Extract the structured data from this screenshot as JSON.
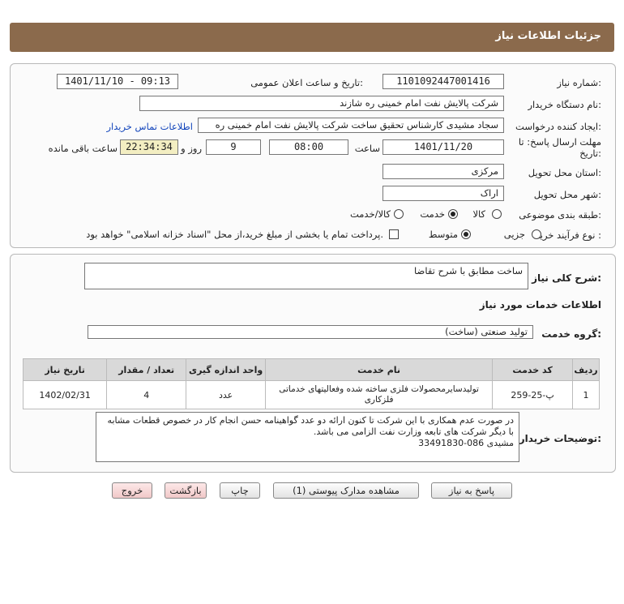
{
  "header": {
    "title": "جزئیات اطلاعات نیاز"
  },
  "fields": {
    "need_number_label": "شماره نیاز:",
    "need_number": "1101092447001416",
    "announce_label": "تاریخ و ساعت اعلان عمومی:",
    "announce_value": "1401/11/10 - 09:13",
    "buyer_org_label": "نام دستگاه خریدار:",
    "buyer_org": "شرکت پالایش نفت امام خمینی  ره   شازند",
    "creator_label": "ایجاد کننده درخواست:",
    "creator": "سجاد مشیدی  کارشناس تحقیق ساخت شرکت پالایش نفت امام خمینی  ره",
    "contact_link": "اطلاعات تماس خریدار",
    "deadline_label": "مهلت ارسال پاسخ: تا",
    "deadline_label2": "تاریخ:",
    "deadline_date": "1401/11/20",
    "time_label": "ساعت",
    "deadline_time": "08:00",
    "days_value": "9",
    "days_label": "روز و",
    "remaining_time": "22:34:34",
    "remaining_label": "ساعت باقی مانده",
    "province_label": "استان محل تحویل:",
    "province": "مرکزی",
    "city_label": "شهر محل تحویل:",
    "city": "اراک",
    "category_label": "طبقه بندی موضوعی:",
    "category_options": [
      "کالا",
      "خدمت",
      "کالا/خدمت"
    ],
    "category_selected": "خدمت",
    "process_label": "نوع فرآیند خرید :",
    "process_options": [
      "جزیی",
      "متوسط"
    ],
    "process_selected": "متوسط",
    "treasury_note": "پرداخت تمام یا بخشی از مبلغ خرید،از محل \"اسناد خزانه اسلامی\" خواهد بود."
  },
  "description": {
    "label": "شرح کلی نیاز:",
    "value": "ساخت مطابق با شرح تقاضا"
  },
  "services": {
    "section_title": "اطلاعات خدمات مورد نیاز",
    "group_label": "گروه خدمت:",
    "group_value": "تولید صنعتی (ساخت)",
    "table": {
      "headers": [
        "ردیف",
        "کد خدمت",
        "نام خدمت",
        "واحد اندازه گیری",
        "تعداد / مقدار",
        "تاریخ نیاز"
      ],
      "rows": [
        [
          "1",
          "پ-25-259",
          "تولیدسایرمحصولات فلزی ساخته شده وفعالیتهای خدماتی فلزکاری",
          "عدد",
          "4",
          "1402/02/31"
        ]
      ]
    }
  },
  "notes": {
    "label": "توضیحات خریدار:",
    "value": "در صورت عدم همکاری با این شرکت تا کنون ارائه دو عدد گواهینامه حسن انجام کار در خصوص قطعات مشابه با دیگر شرکت های تابعه وزارت نفت الزامی می باشد.\nمشیدی 086-33491830"
  },
  "buttons": {
    "reply": "پاسخ به نیاز",
    "attachments": "مشاهده مدارک پیوستی (1)",
    "print": "چاپ",
    "back": "بازگشت",
    "exit": "خروج"
  },
  "colors": {
    "header_bg": "#8b6a4c",
    "link": "#1144bb",
    "time_box": "#f3eec2"
  }
}
